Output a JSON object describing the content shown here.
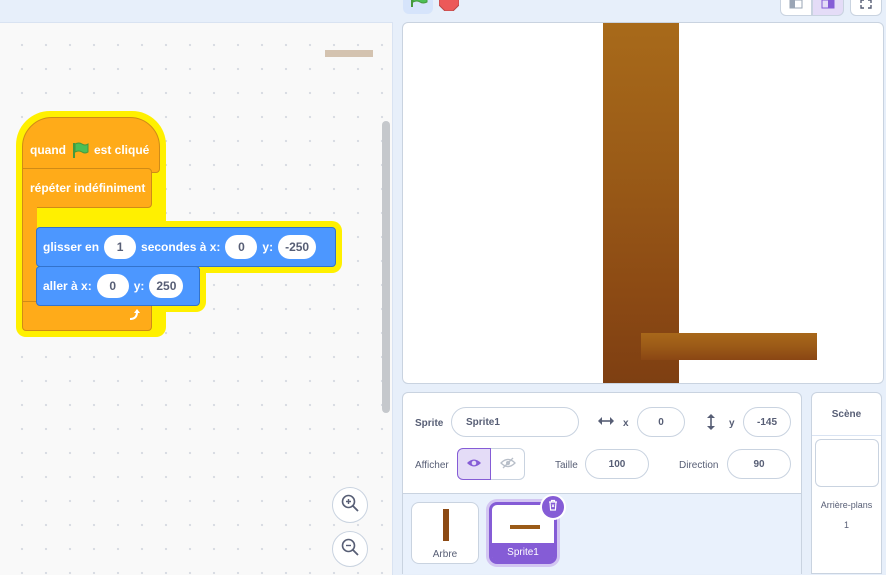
{
  "blocks": {
    "hat": {
      "when": "quand",
      "clicked": "est cliqué"
    },
    "forever": {
      "label": "répéter indéfiniment"
    },
    "glide": {
      "prefix": "glisser en",
      "secs": "1",
      "mid": "secondes à x:",
      "x": "0",
      "ylabel": "y:",
      "y": "-250"
    },
    "goto": {
      "prefix": "aller à x:",
      "x": "0",
      "ylabel": "y:",
      "y": "250"
    }
  },
  "sprite_info": {
    "sprite_label": "Sprite",
    "sprite_name": "Sprite1",
    "x_label": "x",
    "x_value": "0",
    "y_label": "y",
    "y_value": "-145",
    "show_label": "Afficher",
    "size_label": "Taille",
    "size_value": "100",
    "direction_label": "Direction",
    "direction_value": "90"
  },
  "sprites": [
    {
      "name": "Arbre",
      "selected": false
    },
    {
      "name": "Sprite1",
      "selected": true
    }
  ],
  "stage_panel": {
    "title": "Scène",
    "backdrops_label": "Arrière-plans",
    "backdrops_count": "1"
  },
  "colors": {
    "events": "#ffab19",
    "motion": "#4c97ff",
    "accent": "#855cd6",
    "glow": "#fff000"
  },
  "icons": {
    "flag": "green-flag-icon",
    "stop": "stop-icon",
    "zoom_in": "zoom-in-icon",
    "zoom_out": "zoom-out-icon",
    "delete": "trash-icon"
  }
}
